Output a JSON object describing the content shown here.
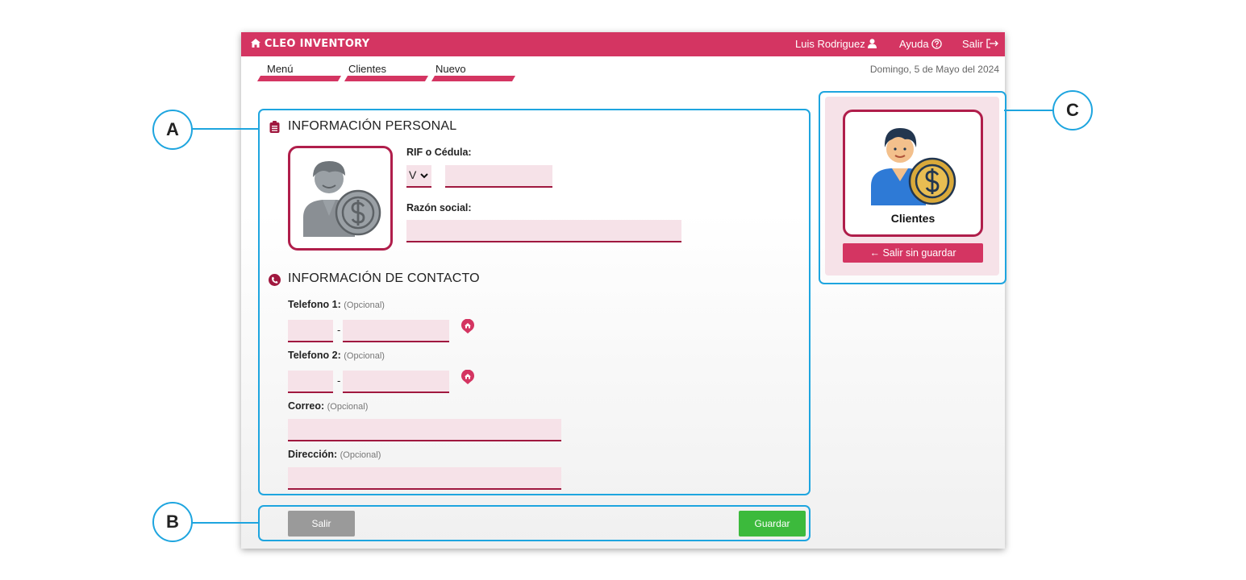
{
  "app": {
    "brand": "CLEO INVENTORY",
    "user": "Luis Rodriguez",
    "help": "Ayuda",
    "logout": "Salir",
    "date": "Domingo, 5 de Mayo del 2024"
  },
  "breadcrumbs": [
    "Menú",
    "Clientes",
    "Nuevo"
  ],
  "personal": {
    "title": "INFORMACIÓN PERSONAL",
    "rif_label": "RIF o Cédula:",
    "rif_type": "V",
    "razon_label": "Razón social:"
  },
  "contact": {
    "title": "INFORMACIÓN DE CONTACTO",
    "phone1_label": "Telefono 1:",
    "phone2_label": "Telefono 2:",
    "email_label": "Correo:",
    "address_label": "Dirección:",
    "optional": "(Opcional)",
    "separator": "-"
  },
  "buttons": {
    "exit": "Salir",
    "save": "Guardar"
  },
  "side": {
    "card_label": "Clientes",
    "exit_no_save": "← Salir sin guardar"
  },
  "annotations": [
    "A",
    "B",
    "C"
  ],
  "colors": {
    "brand": "#d43562",
    "accent_dark": "#a0183f",
    "field_bg": "#f6e2e8",
    "save": "#3cba3c",
    "exit": "#9a9a9a",
    "callout": "#1ea5df"
  }
}
